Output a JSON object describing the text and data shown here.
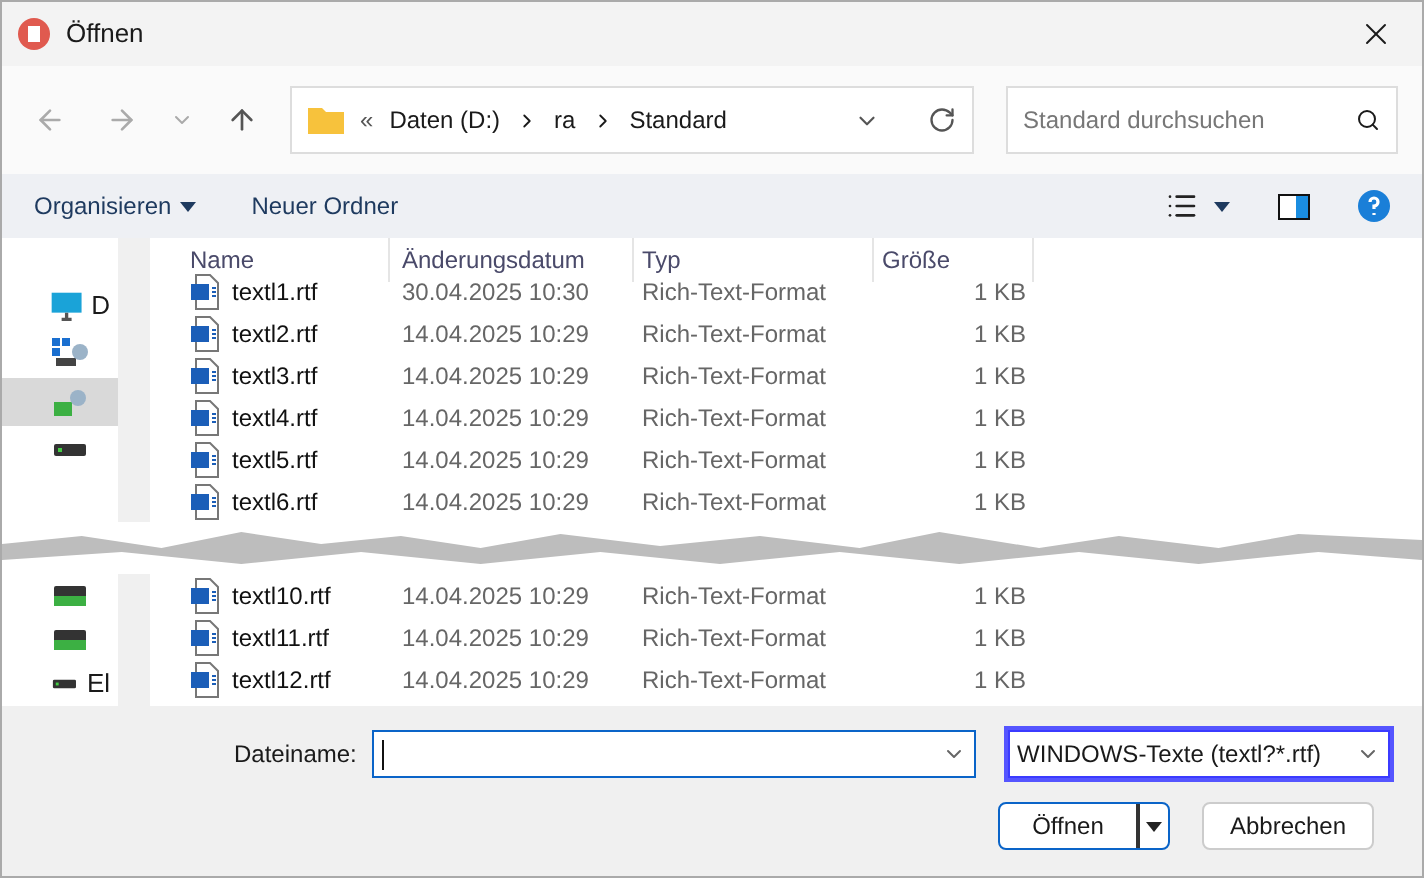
{
  "window": {
    "title": "Öffnen"
  },
  "address": {
    "parts": [
      "«",
      "Daten (D:)",
      "ra",
      "Standard"
    ]
  },
  "search": {
    "placeholder": "Standard durchsuchen"
  },
  "toolbar": {
    "organize": "Organisieren",
    "new_folder": "Neuer Ordner"
  },
  "sidebar": {
    "items": [
      {
        "kind": "pc",
        "label": "D",
        "selected": false
      },
      {
        "kind": "network",
        "selected": false
      },
      {
        "kind": "network-drive",
        "selected": true
      },
      {
        "kind": "drive",
        "selected": false
      }
    ],
    "items_lower": [
      {
        "kind": "green-drive",
        "selected": false
      },
      {
        "kind": "green-drive",
        "selected": false
      },
      {
        "kind": "drive",
        "label": "El",
        "selected": false
      }
    ]
  },
  "table": {
    "columns": [
      "Name",
      "Änderungsdatum",
      "Typ",
      "Größe"
    ],
    "rows": [
      {
        "name": "textl1.rtf",
        "date": "30.04.2025 10:30",
        "type": "Rich-Text-Format",
        "size": "1 KB"
      },
      {
        "name": "textl2.rtf",
        "date": "14.04.2025 10:29",
        "type": "Rich-Text-Format",
        "size": "1 KB"
      },
      {
        "name": "textl3.rtf",
        "date": "14.04.2025 10:29",
        "type": "Rich-Text-Format",
        "size": "1 KB"
      },
      {
        "name": "textl4.rtf",
        "date": "14.04.2025 10:29",
        "type": "Rich-Text-Format",
        "size": "1 KB"
      },
      {
        "name": "textl5.rtf",
        "date": "14.04.2025 10:29",
        "type": "Rich-Text-Format",
        "size": "1 KB"
      },
      {
        "name": "textl6.rtf",
        "date": "14.04.2025 10:29",
        "type": "Rich-Text-Format",
        "size": "1 KB"
      }
    ],
    "rows_lower": [
      {
        "name": "textl10.rtf",
        "date": "14.04.2025 10:29",
        "type": "Rich-Text-Format",
        "size": "1 KB"
      },
      {
        "name": "textl11.rtf",
        "date": "14.04.2025 10:29",
        "type": "Rich-Text-Format",
        "size": "1 KB"
      },
      {
        "name": "textl12.rtf",
        "date": "14.04.2025 10:29",
        "type": "Rich-Text-Format",
        "size": "1 KB"
      }
    ]
  },
  "filename": {
    "label": "Dateiname:"
  },
  "filter": {
    "value": "WINDOWS-Texte (textl?*.rtf)",
    "highlighted": true
  },
  "buttons": {
    "open": "Öffnen",
    "cancel": "Abbrechen"
  }
}
